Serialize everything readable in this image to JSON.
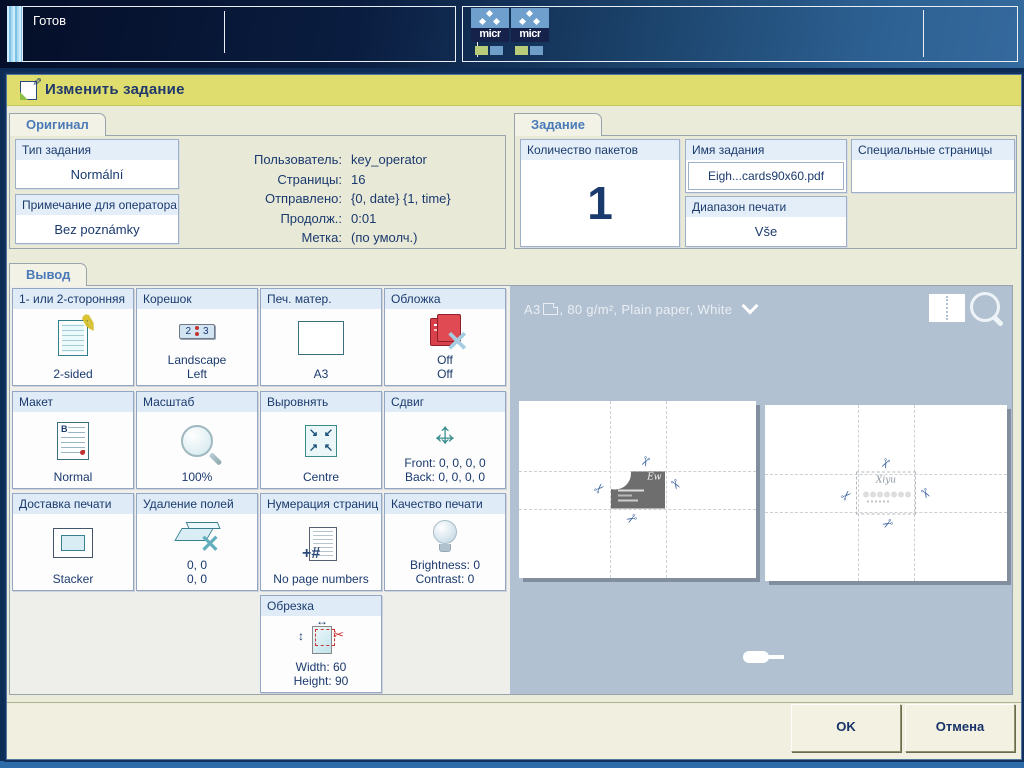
{
  "colors": {
    "title_bar": "#dedd6e",
    "navy_text": "#1a3a6e",
    "tab_label": "#4a7ab8",
    "tile_header": "#dfecf7",
    "preview_bg": "#b2c1d1",
    "status_green": "#b8cc7a",
    "status_blue": "#6f9fc9"
  },
  "topbar": {
    "status": "Готов",
    "logos": [
      {
        "label": "micr"
      },
      {
        "label": "micr"
      }
    ]
  },
  "dialog": {
    "title": "Изменить задание",
    "original": {
      "tab": "Оригинал",
      "fields": [
        {
          "label": "Тип задания",
          "value": "Normální"
        },
        {
          "label": "Примечание для оператора",
          "value": "Bez poznámky"
        }
      ],
      "info": [
        {
          "label": "Пользователь:",
          "value": "key_operator"
        },
        {
          "label": "Страницы:",
          "value": "16"
        },
        {
          "label": "Отправлено:",
          "value": "{0, date} {1, time}"
        },
        {
          "label": "Продолж.:",
          "value": "0:01"
        },
        {
          "label": "Метка:",
          "value": "(по умолч.)"
        }
      ]
    },
    "job": {
      "tab": "Задание",
      "copies_label": "Количество пакетов",
      "copies_value": "1",
      "name_label": "Имя задания",
      "name_value": "Eigh...cards90x60.pdf",
      "range_label": "Диапазон печати",
      "range_value": "Vše",
      "special_label": "Специальные страницы"
    },
    "output": {
      "tab": "Вывод",
      "tiles": [
        {
          "label": "1- или 2-сторонняя",
          "value": "2-sided"
        },
        {
          "label": "Корешок",
          "value": "Landscape\nLeft"
        },
        {
          "label": "Печ. матер.",
          "value": "A3"
        },
        {
          "label": "Обложка",
          "value": "Off\nOff"
        },
        {
          "label": "Макет",
          "value": "Normal"
        },
        {
          "label": "Масштаб",
          "value": "100%"
        },
        {
          "label": "Выровнять",
          "value": "Centre"
        },
        {
          "label": "Сдвиг",
          "value": "Front: 0, 0, 0, 0\nBack: 0, 0, 0, 0"
        },
        {
          "label": "Доставка печати",
          "value": "Stacker"
        },
        {
          "label": "Удаление полей",
          "value": "0, 0\n0, 0"
        },
        {
          "label": "Нумерация страниц",
          "value": "No page numbers"
        },
        {
          "label": "Качество печати",
          "value": "Brightness: 0\nContrast: 0"
        },
        {
          "label": "Обрезка",
          "value": "Width: 60\nHeight: 90"
        }
      ],
      "binding_icon_left": "2",
      "binding_icon_right": "3",
      "page_numbers_glyph": "+#",
      "preview": {
        "media": "A3",
        "media_details": ", 80 g/m², Plain paper, White"
      }
    },
    "ok": "OK",
    "cancel": "Отмена"
  }
}
